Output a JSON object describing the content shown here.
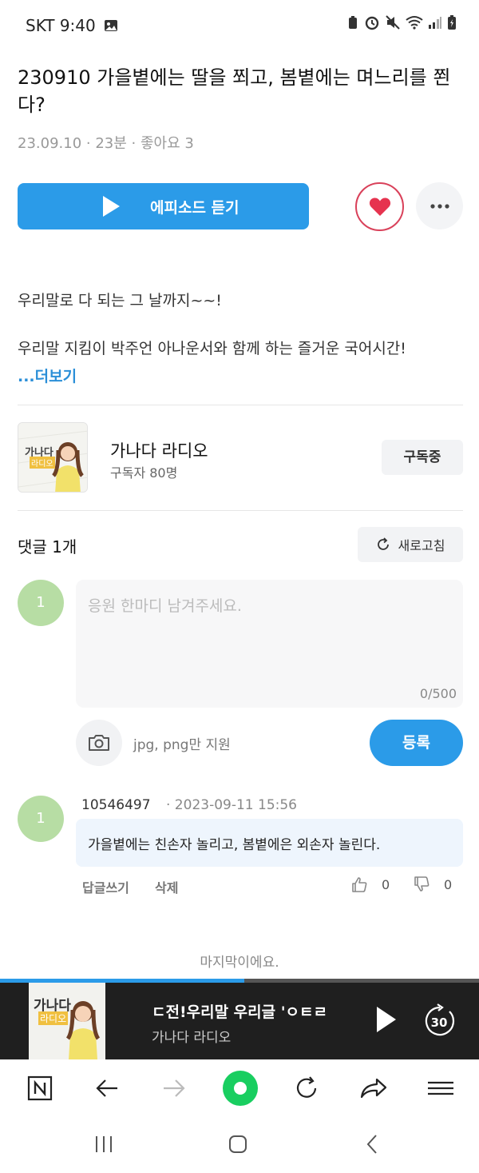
{
  "status_bar": {
    "carrier_time": "SKT 9:40"
  },
  "episode": {
    "title": "230910 가을볕에는 딸을 쬐고, 봄볕에는 며느리를 쬔다?",
    "meta": "23.09.10 · 23분 · 좋아요 3",
    "listen_label": "에피소드 듣기",
    "description_line1": "우리말로 다 되는 그 날까지~~!",
    "description_line2": "우리말 지킴이 박주언 아나운서와 함께 하는 즐거운 국어시간!",
    "more_label": "...더보기"
  },
  "channel": {
    "name": "가나다 라디오",
    "subscribers": "구독자 80명",
    "subscribe_label": "구독중",
    "thumb_text_line1": "가나다",
    "thumb_text_line2": "라디오"
  },
  "comments": {
    "title": "댓글 1개",
    "refresh_label": "새로고침",
    "my_avatar": "1",
    "input_placeholder": "응원 한마디 남겨주세요.",
    "char_count": "0/500",
    "image_hint": "jpg, png만 지원",
    "submit_label": "등록",
    "items": [
      {
        "avatar": "1",
        "author": "10546497",
        "date": "· 2023-09-11 15:56",
        "text": "가을볕에는 친손자 놀리고, 봄볕에은 외손자 놀린다.",
        "reply_label": "답글쓰기",
        "delete_label": "삭제",
        "likes": "0",
        "dislikes": "0"
      }
    ],
    "end_text": "마지막이에요."
  },
  "player": {
    "progress_fraction": 0.51,
    "title": "ㄷ전!우리말 우리글 'ㅇㅌㄹ",
    "subtitle": "가나다 라디오",
    "skip_label": "30"
  },
  "colors": {
    "accent": "#2b9be8",
    "like_red": "#e6334f",
    "avatar_green": "#b7dda4",
    "naver_green": "#19ce60"
  }
}
